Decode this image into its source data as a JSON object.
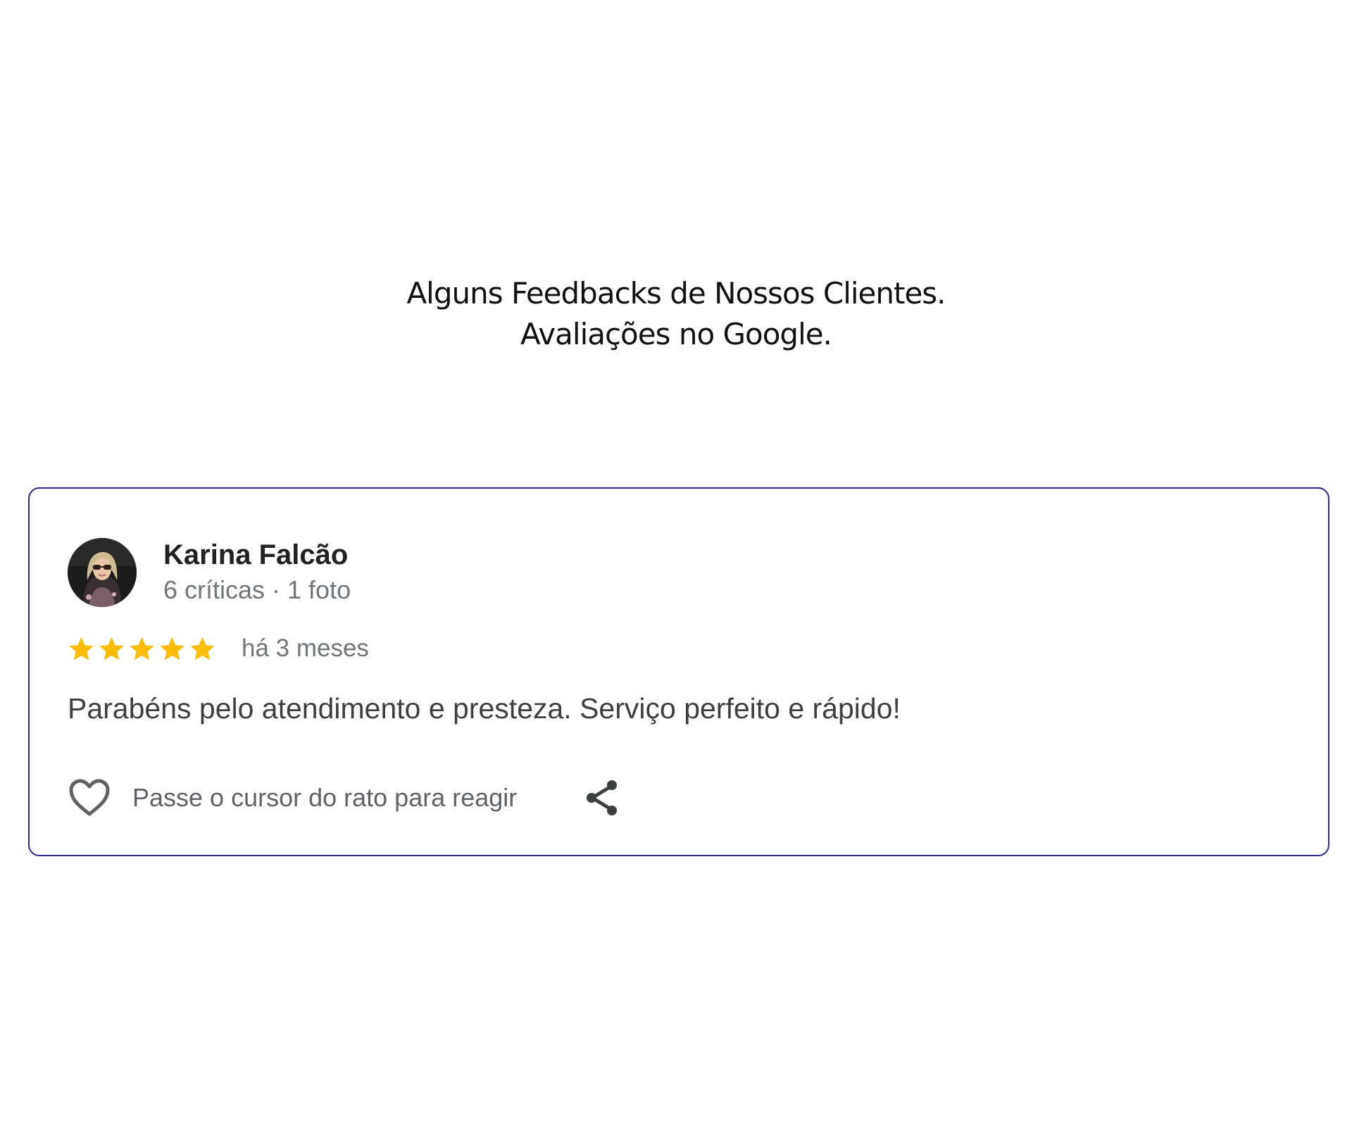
{
  "heading": {
    "line1": "Alguns Feedbacks de Nossos Clientes.",
    "line2": "Avaliações no Google."
  },
  "review": {
    "reviewer_name": "Karina Falcão",
    "reviewer_meta": "6 críticas · 1 foto",
    "rating": 5,
    "rating_max": 5,
    "age": "há 3 meses",
    "text": "Parabéns pelo atendimento e presteza. Serviço perfeito e rápido!",
    "reaction_label": "Passe o cursor do rato para reagir",
    "icons": {
      "avatar": "reviewer-photo",
      "star": "star-icon",
      "heart": "heart-icon",
      "share": "share-icon"
    }
  },
  "colors": {
    "card_border": "#2b2a8c",
    "star": "#fbbc04",
    "name": "#222222",
    "muted": "#70757a",
    "text": "#3c4043"
  }
}
